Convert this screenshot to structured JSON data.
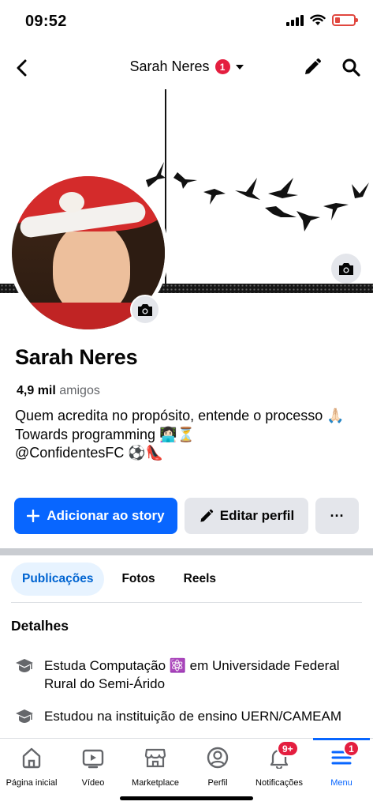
{
  "status": {
    "time": "09:52"
  },
  "header": {
    "title": "Sarah Neres",
    "badge": "1"
  },
  "profile": {
    "name": "Sarah Neres",
    "friends_count": "4,9 mil",
    "friends_label": "amigos",
    "bio": "Quem acredita no propósito, entende o processo 🙏🏻\nTowards programming 👩🏻‍💻⏳\n@ConfidentesFC ⚽️👠"
  },
  "actions": {
    "add_story": "Adicionar ao story",
    "edit_profile": "Editar perfil",
    "more": "···"
  },
  "tabs": [
    {
      "label": "Publicações",
      "active": true
    },
    {
      "label": "Fotos",
      "active": false
    },
    {
      "label": "Reels",
      "active": false
    }
  ],
  "details": {
    "title": "Detalhes",
    "items": [
      {
        "icon": "graduation-cap-icon",
        "text": "Estuda Computação ⚛️ em Universidade Federal Rural do Semi-Árido"
      },
      {
        "icon": "graduation-cap-icon",
        "text": "Estudou na instituição de ensino UERN/CAMEAM"
      }
    ]
  },
  "bottom_nav": {
    "items": [
      {
        "label": "Página inicial",
        "icon": "home-icon"
      },
      {
        "label": "Vídeo",
        "icon": "video-icon"
      },
      {
        "label": "Marketplace",
        "icon": "marketplace-icon"
      },
      {
        "label": "Perfil",
        "icon": "profile-icon"
      },
      {
        "label": "Notificações",
        "icon": "bell-icon",
        "badge": "9+"
      },
      {
        "label": "Menu",
        "icon": "menu-icon",
        "badge": "1",
        "active": true
      }
    ]
  },
  "colors": {
    "accent": "#0866ff",
    "badge": "#e41e3f",
    "secondary_button": "#e4e6eb"
  }
}
